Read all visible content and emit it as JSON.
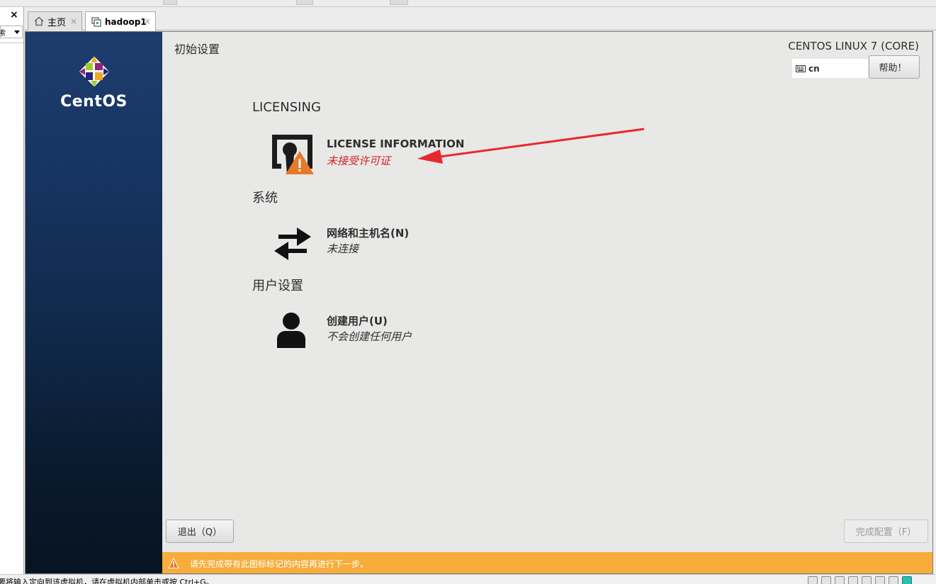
{
  "window": {
    "side_close": "×",
    "side_dropdown_value": "索"
  },
  "tabs": [
    {
      "label": "主页",
      "icon": "home-icon",
      "close": "×"
    },
    {
      "label": "hadoop1",
      "icon": "vm-icon",
      "close": "×"
    }
  ],
  "installer": {
    "brand": "CentOS",
    "page_title": "初始设置",
    "os_title": "CENTOS LINUX 7 (CORE)",
    "keyboard_layout": "cn",
    "help_label": "帮助！",
    "sections": [
      {
        "category": "LICENSING",
        "spoke": {
          "title": "LICENSE INFORMATION",
          "status": "未接受许可证",
          "status_warning": true,
          "icon": "license-warning-icon"
        }
      },
      {
        "category": "系统",
        "spoke": {
          "title": "网络和主机名(N)",
          "status": "未连接",
          "status_warning": false,
          "icon": "network-arrows-icon"
        }
      },
      {
        "category": "用户设置",
        "spoke": {
          "title": "创建用户(U)",
          "status": "不会创建任何用户",
          "status_warning": false,
          "icon": "user-icon"
        }
      }
    ],
    "quit_label": "退出（Q）",
    "finish_label": "完成配置（F）",
    "warning_message": "请先完成带有此图标标记的内容再进行下一步。",
    "colors": {
      "warning_bar": "#f7ad3b",
      "status_warning_text": "#d3202a",
      "annotation_arrow": "#e8282e"
    }
  },
  "statusbar": {
    "text": "要将输入定向到该虚拟机，请在虚拟机内部单击或按 Ctrl+G。"
  }
}
